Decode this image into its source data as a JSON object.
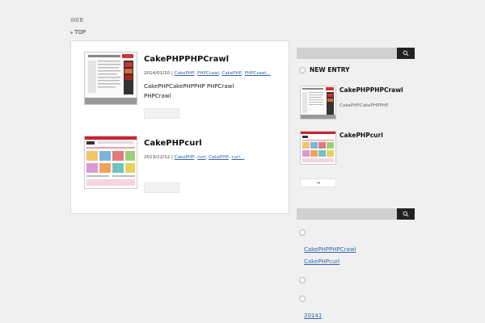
{
  "site": {
    "label": "WEB"
  },
  "breadcrumb": {
    "top": "TOP"
  },
  "posts": [
    {
      "title": "CakePHPPHPCrawl",
      "date": "2014/01/10",
      "sep": " | ",
      "tags": [
        "CakePHP",
        "PHPCrawl",
        "CakePHP",
        "PHPCrawl..."
      ],
      "excerpt": [
        "CakePHPCakePHPPHP PHPCrawl",
        "PHPCrawl"
      ]
    },
    {
      "title": "CakePHPcurl",
      "date": "2013/12/12",
      "sep": " | ",
      "tags": [
        "CakePHP",
        "curl",
        "CakePHP",
        "curl..."
      ]
    }
  ],
  "sidebar": {
    "new_entry_heading": "NEW ENTRY",
    "entries": [
      {
        "title": "CakePHPPHPCrawl",
        "desc": "CakePHPCakePHPPHP"
      },
      {
        "title": "CakePHPcurl",
        "desc": ""
      }
    ],
    "more_arrow": "→",
    "links_1": [
      "CakePHPPHPCrawl",
      "CakePHPcurl"
    ],
    "links_2": [
      "20141"
    ]
  },
  "icons": {
    "search": "search-icon"
  },
  "colors": {
    "search_button": "#222222",
    "link": "#3366aa"
  }
}
